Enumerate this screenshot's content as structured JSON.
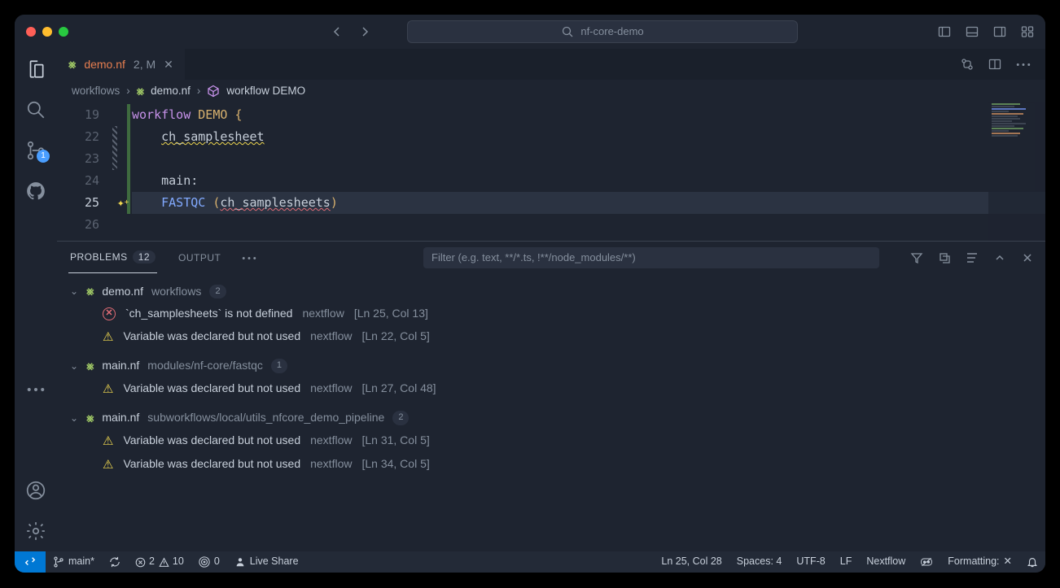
{
  "titlebar": {
    "search_text": "nf-core-demo"
  },
  "activity": {
    "scm_badge": "1"
  },
  "tab": {
    "filename": "demo.nf",
    "modified": "2, M"
  },
  "breadcrumb": {
    "folder": "workflows",
    "file": "demo.nf",
    "symbol": "workflow DEMO"
  },
  "editor": {
    "lines": [
      {
        "n": "19",
        "hl": false
      },
      {
        "n": "22",
        "hl": false
      },
      {
        "n": "23",
        "hl": false
      },
      {
        "n": "24",
        "hl": false
      },
      {
        "n": "25",
        "hl": true,
        "sparkle": true
      },
      {
        "n": "26",
        "hl": false
      }
    ],
    "code": {
      "l19": {
        "kw": "workflow",
        "name": "DEMO",
        "brace": "{"
      },
      "l22": {
        "var": "ch_samplesheet"
      },
      "l24": {
        "label": "main:"
      },
      "l25": {
        "fn": "FASTQC",
        "arg": "ch_samplesheets"
      }
    }
  },
  "panel": {
    "tabs": {
      "problems": "PROBLEMS",
      "problems_count": "12",
      "output": "OUTPUT"
    },
    "filter_placeholder": "Filter (e.g. text, **/*.ts, !**/node_modules/**)",
    "groups": [
      {
        "file": "demo.nf",
        "path": "workflows",
        "count": "2",
        "items": [
          {
            "sev": "err",
            "msg": "`ch_samplesheets` is not defined",
            "src": "nextflow",
            "loc": "[Ln 25, Col 13]"
          },
          {
            "sev": "warn",
            "msg": "Variable was declared but not used",
            "src": "nextflow",
            "loc": "[Ln 22, Col 5]"
          }
        ]
      },
      {
        "file": "main.nf",
        "path": "modules/nf-core/fastqc",
        "count": "1",
        "items": [
          {
            "sev": "warn",
            "msg": "Variable was declared but not used",
            "src": "nextflow",
            "loc": "[Ln 27, Col 48]"
          }
        ]
      },
      {
        "file": "main.nf",
        "path": "subworkflows/local/utils_nfcore_demo_pipeline",
        "count": "2",
        "items": [
          {
            "sev": "warn",
            "msg": "Variable was declared but not used",
            "src": "nextflow",
            "loc": "[Ln 31, Col 5]"
          },
          {
            "sev": "warn",
            "msg": "Variable was declared but not used",
            "src": "nextflow",
            "loc": "[Ln 34, Col 5]"
          }
        ]
      }
    ]
  },
  "status": {
    "branch": "main*",
    "errors": "2",
    "warnings": "10",
    "ports": "0",
    "liveshare": "Live Share",
    "cursor": "Ln 25, Col 28",
    "indent": "Spaces: 4",
    "encoding": "UTF-8",
    "eol": "LF",
    "lang": "Nextflow",
    "formatting": "Formatting:"
  }
}
